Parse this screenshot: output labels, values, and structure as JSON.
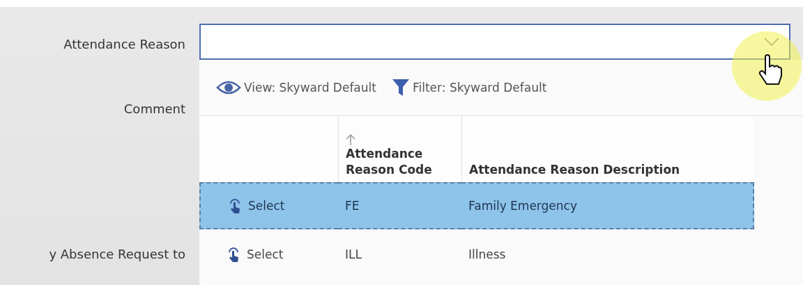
{
  "labels": [
    "Attendance Reason",
    "Comment",
    "y Absence Request to"
  ],
  "field": {
    "expanded": true
  },
  "toolbar": {
    "view": "View: Skyward Default",
    "filter": "Filter: Skyward Default"
  },
  "table": {
    "columns": [
      {
        "label": "Attendance Reason Code",
        "sorted": true
      },
      {
        "label": "Attendance Reason Description",
        "sorted": false
      }
    ],
    "rows": [
      {
        "action": "Select",
        "code": "FE",
        "description": "Family Emergency",
        "selected": true
      },
      {
        "action": "Select",
        "code": "ILL",
        "description": "Illness",
        "selected": false
      }
    ]
  }
}
